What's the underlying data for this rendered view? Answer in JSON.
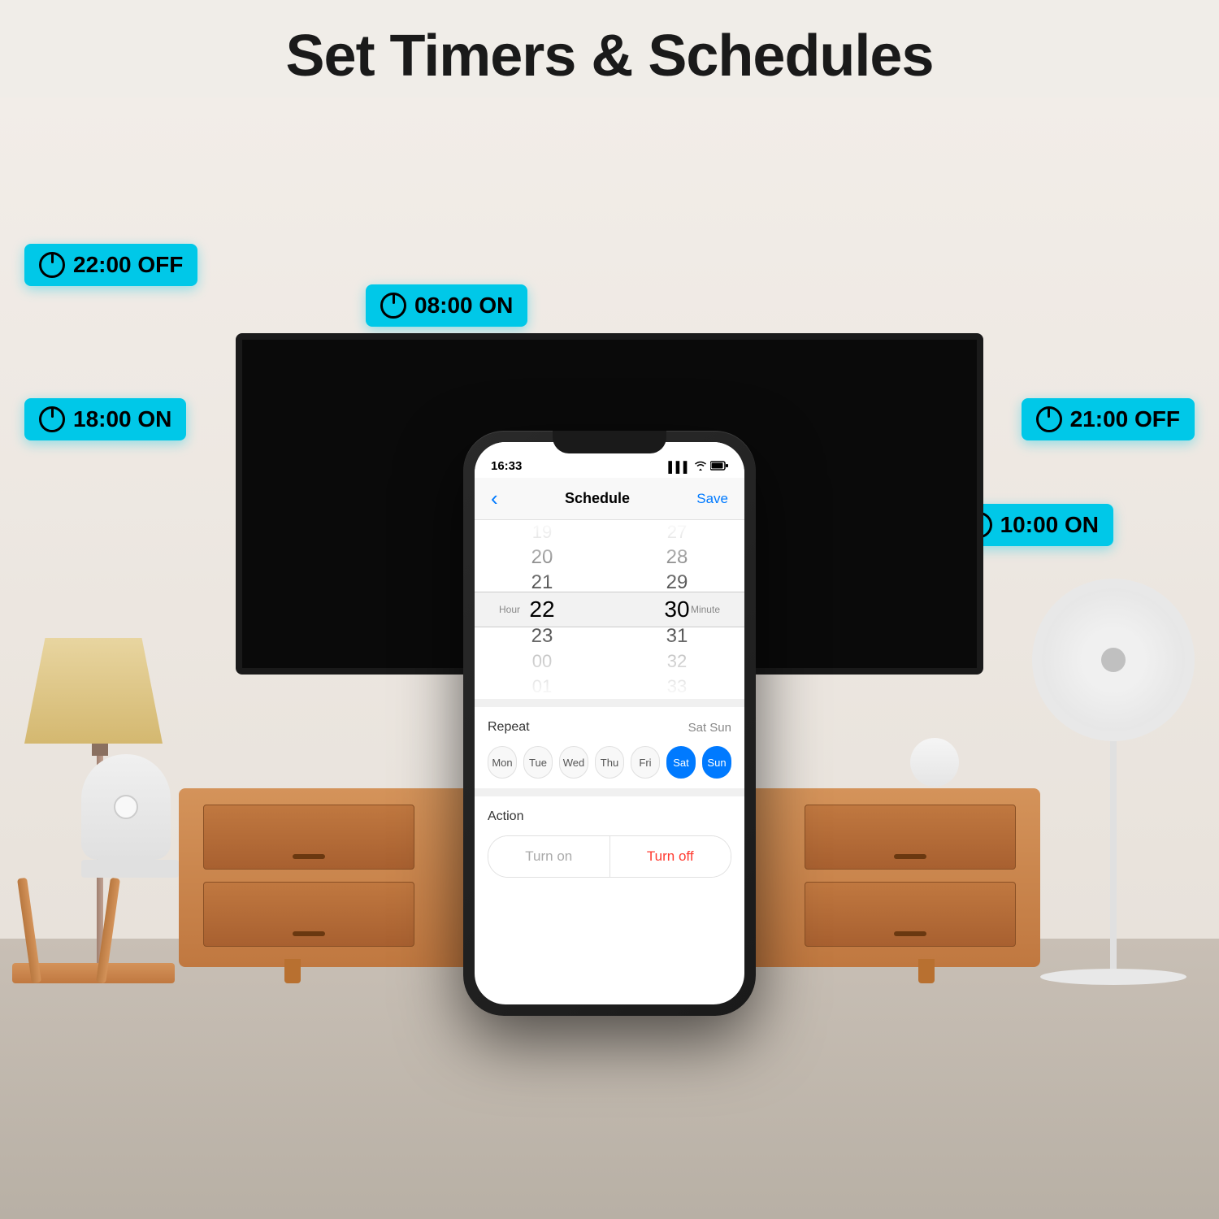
{
  "page": {
    "title": "Set Timers & Schedules"
  },
  "timer_badges": {
    "badge_off_22": "22:00 OFF",
    "badge_on_8": "08:00 ON",
    "badge_on_18": "18:00 ON",
    "badge_off_21": "21:00 OFF",
    "badge_on_10": "10:00 ON"
  },
  "phone": {
    "status_bar": {
      "time": "16:33",
      "signal": "▌▌▌",
      "wifi": "WiFi",
      "battery": "🔋"
    },
    "nav": {
      "back": "‹",
      "title": "Schedule",
      "save": "Save"
    },
    "time_picker": {
      "label_hour": "Hour",
      "label_minute": "Minute",
      "hours": [
        "19",
        "20",
        "21",
        "22",
        "23",
        "00",
        "01"
      ],
      "minutes": [
        "27",
        "28",
        "29",
        "30",
        "31",
        "32",
        "33"
      ],
      "selected_hour": "22",
      "selected_minute": "30"
    },
    "repeat": {
      "title": "Repeat",
      "value": "Sat Sun",
      "days": [
        {
          "label": "Mon",
          "active": false
        },
        {
          "label": "Tue",
          "active": false
        },
        {
          "label": "Wed",
          "active": false
        },
        {
          "label": "Thu",
          "active": false
        },
        {
          "label": "Fri",
          "active": false
        },
        {
          "label": "Sat",
          "active": true
        },
        {
          "label": "Sun",
          "active": true
        }
      ]
    },
    "action": {
      "title": "Action",
      "turn_on_label": "Turn on",
      "turn_off_label": "Turn off"
    }
  }
}
